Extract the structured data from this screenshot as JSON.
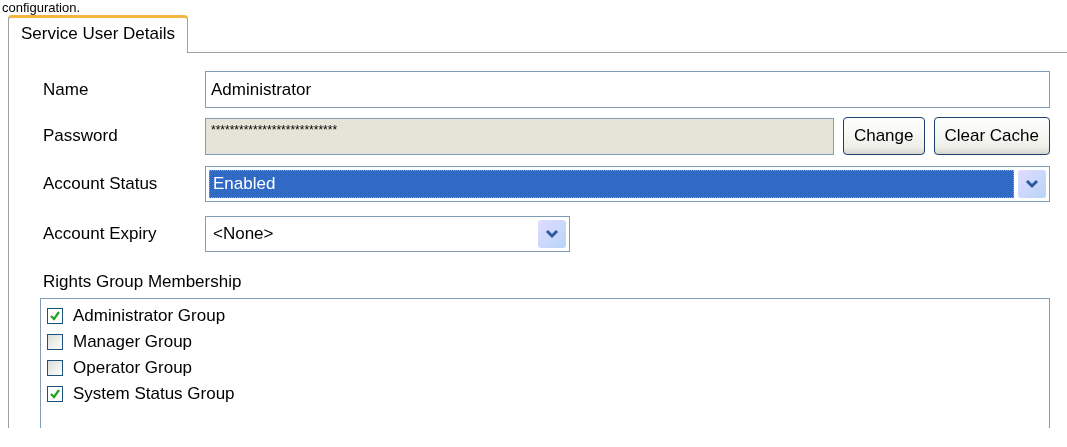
{
  "caption": "configuration.",
  "tabs": [
    {
      "label": "Service User Details",
      "selected": true
    }
  ],
  "fields": [
    {
      "kind": "text",
      "label": "Name",
      "value": "Administrator",
      "disabled": false
    },
    {
      "kind": "text",
      "label": "Password",
      "value": "***************************",
      "disabled": true,
      "buttons": [
        "Change",
        "Clear Cache"
      ]
    },
    {
      "kind": "select",
      "label": "Account Status",
      "value": "Enabled",
      "focused": true
    },
    {
      "kind": "select",
      "label": "Account Expiry",
      "value": "<None>",
      "focused": false
    }
  ],
  "rights_group": {
    "label": "Rights Group Membership",
    "items": [
      {
        "label": "Administrator Group",
        "checked": true
      },
      {
        "label": "Manager Group",
        "checked": false
      },
      {
        "label": "Operator Group",
        "checked": false
      },
      {
        "label": "System Status Group",
        "checked": true
      }
    ]
  }
}
